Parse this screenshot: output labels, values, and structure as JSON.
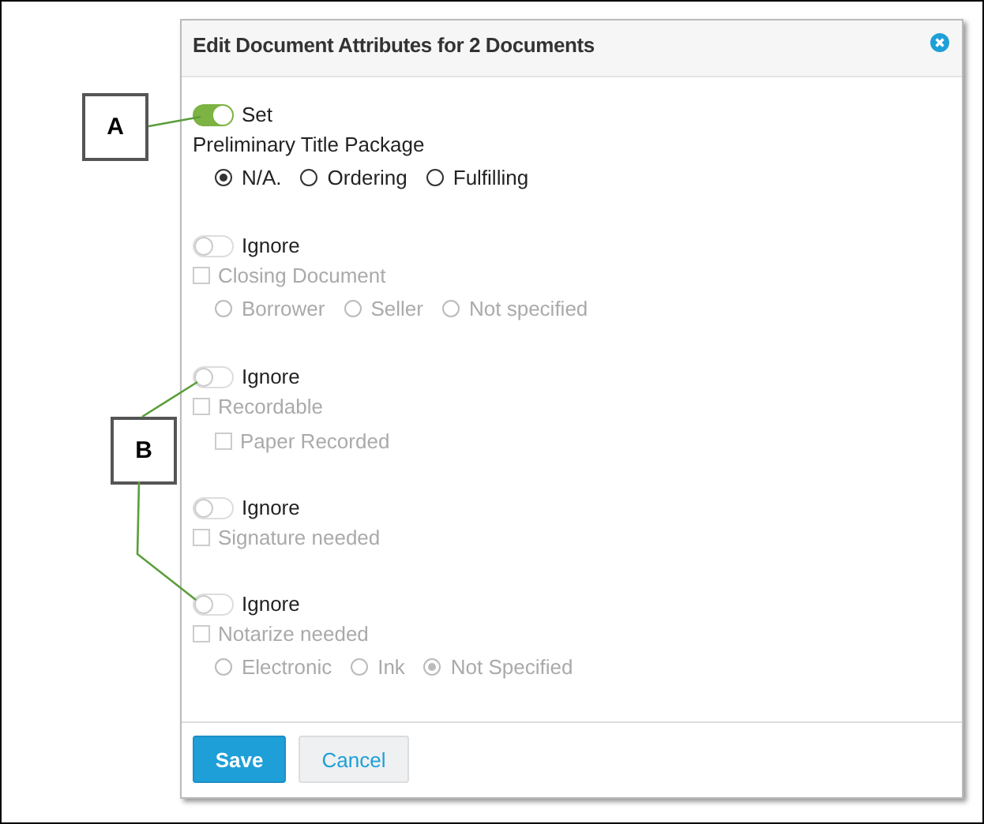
{
  "dialog": {
    "title": "Edit Document Attributes for 2 Documents",
    "sections": [
      {
        "toggle": {
          "on": true,
          "label": "Set"
        },
        "items": [
          {
            "kind": "heading",
            "label": "Preliminary Title Package"
          },
          {
            "kind": "radios",
            "options": [
              {
                "label": "N/A.",
                "selected": true
              },
              {
                "label": "Ordering",
                "selected": false
              },
              {
                "label": "Fulfilling",
                "selected": false
              }
            ]
          }
        ]
      },
      {
        "toggle": {
          "on": false,
          "label": "Ignore"
        },
        "items": [
          {
            "kind": "checkbox",
            "label": "Closing Document",
            "checked": false
          },
          {
            "kind": "radios",
            "options": [
              {
                "label": "Borrower",
                "selected": false
              },
              {
                "label": "Seller",
                "selected": false
              },
              {
                "label": "Not specified",
                "selected": false
              }
            ]
          }
        ]
      },
      {
        "toggle": {
          "on": false,
          "label": "Ignore"
        },
        "items": [
          {
            "kind": "checkbox",
            "label": "Recordable",
            "checked": false,
            "children": [
              {
                "kind": "checkbox",
                "label": "Paper Recorded",
                "checked": false
              }
            ]
          }
        ]
      },
      {
        "toggle": {
          "on": false,
          "label": "Ignore"
        },
        "items": [
          {
            "kind": "checkbox",
            "label": "Signature needed",
            "checked": false
          }
        ]
      },
      {
        "toggle": {
          "on": false,
          "label": "Ignore"
        },
        "items": [
          {
            "kind": "checkbox",
            "label": "Notarize needed",
            "checked": false
          },
          {
            "kind": "radios",
            "options": [
              {
                "label": "Electronic",
                "selected": false
              },
              {
                "label": "Ink",
                "selected": false
              },
              {
                "label": "Not Specified",
                "selected": true
              }
            ]
          }
        ]
      }
    ],
    "buttons": [
      {
        "kind": "primary",
        "label": "Save"
      },
      {
        "kind": "secondary",
        "label": "Cancel"
      }
    ]
  },
  "callouts": [
    {
      "label": "A"
    },
    {
      "label": "B"
    }
  ]
}
